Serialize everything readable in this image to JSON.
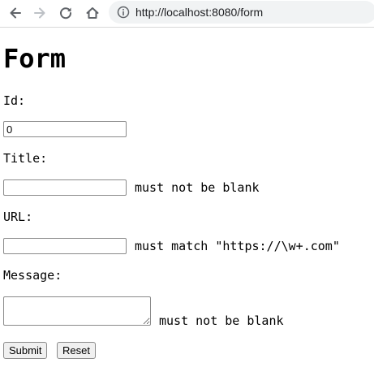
{
  "browser": {
    "url": "http://localhost:8080/form"
  },
  "form": {
    "title": "Form",
    "id": {
      "label": "Id:",
      "value": "0"
    },
    "title_field": {
      "label": "Title:",
      "value": "",
      "error": "must not be blank"
    },
    "url_field": {
      "label": "URL:",
      "value": "",
      "error": "must match \"https://\\w+.com\""
    },
    "message_field": {
      "label": "Message:",
      "value": "",
      "error": "must not be blank"
    },
    "submit_label": "Submit",
    "reset_label": "Reset"
  }
}
